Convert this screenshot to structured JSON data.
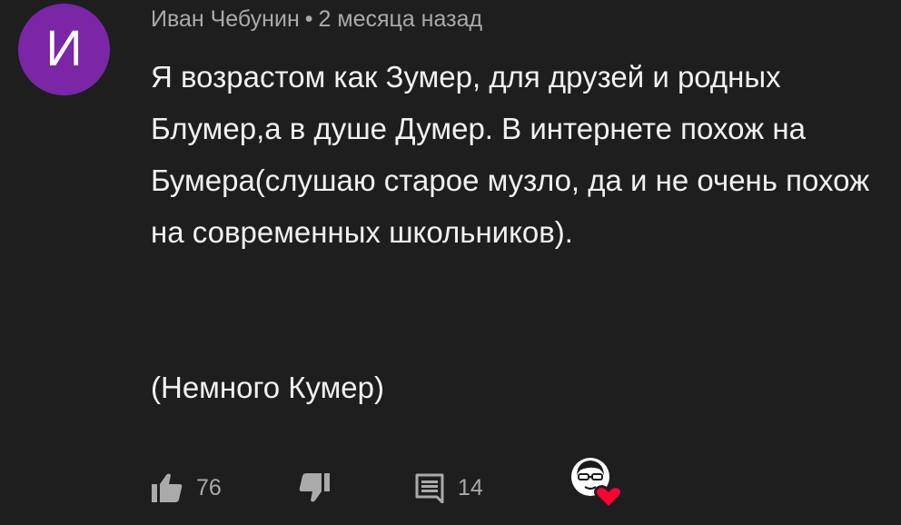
{
  "author": {
    "avatar_letter": "И",
    "avatar_color": "#7b26a6",
    "name": "Иван Чебунин",
    "separator": "•",
    "time": "2 месяца назад"
  },
  "comment": {
    "paragraph_1": "Я возрастом как Зумер, для друзей и родных Блумер,а в душе Думер. В интернете похож на Бумера(слушаю старое музло, да и не очень похож на современных школьников).",
    "paragraph_2": "(Немного Кумер)"
  },
  "actions": {
    "like_icon": "thumbs-up-icon",
    "like_count": "76",
    "dislike_icon": "thumbs-down-icon",
    "reply_icon": "comment-icon",
    "reply_count": "14",
    "creator_heart_icon": "creator-heart-icon"
  },
  "colors": {
    "background": "#1f1e1f",
    "text": "#f1f1f1",
    "secondary_text": "#aaaaaa",
    "heart": "#ff0033"
  }
}
